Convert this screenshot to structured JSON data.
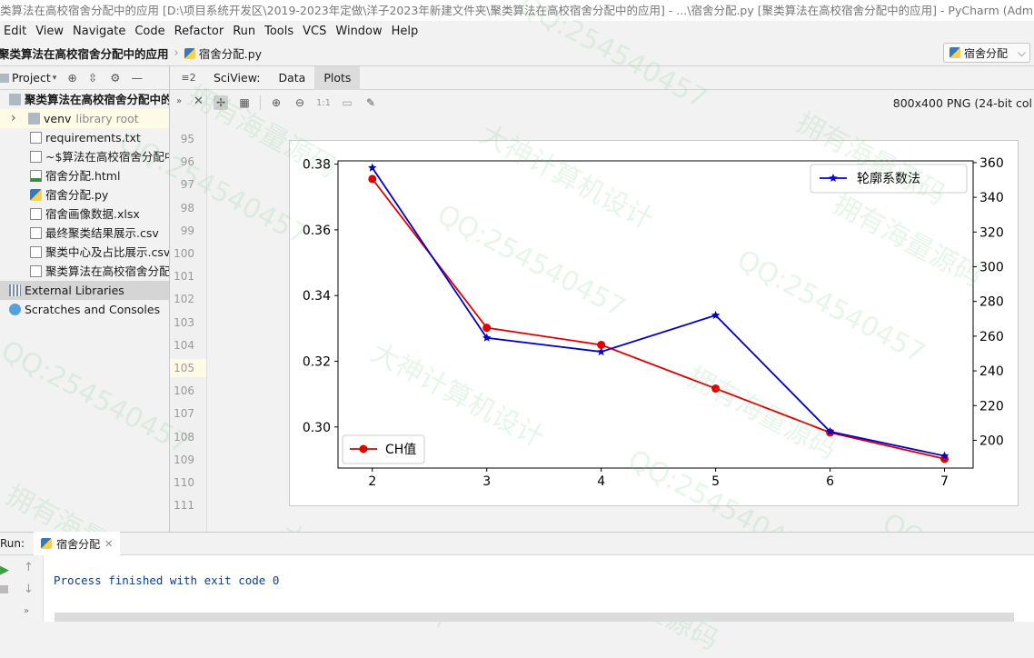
{
  "window": {
    "title": "类算法在高校宿舍分配中的应用 [D:\\项目系统开发区\\2019-2023年定做\\洋子2023年新建文件夹\\聚类算法在高校宿舍分配中的应用] - ...\\宿舍分配.py [聚类算法在高校宿舍分配中的应用] - PyCharm (Administrator)"
  },
  "menu": [
    "Edit",
    "View",
    "Navigate",
    "Code",
    "Refactor",
    "Run",
    "Tools",
    "VCS",
    "Window",
    "Help"
  ],
  "nav": {
    "project": "聚类算法在高校宿舍分配中的应用",
    "file": "宿舍分配.py",
    "run_config": "宿舍分配"
  },
  "project_panel": {
    "header": "Project",
    "tree": [
      {
        "label": "聚类算法在高校宿舍分配中的应用",
        "icon": "folder-icon",
        "indent": 0,
        "bold": true
      },
      {
        "label": "venv",
        "extra": "library root",
        "icon": "folder-icon",
        "indent": 1
      },
      {
        "label": "requirements.txt",
        "icon": "file-icon",
        "indent": 2
      },
      {
        "label": "~$算法在高校宿舍分配中的",
        "icon": "file-icon",
        "indent": 2
      },
      {
        "label": "宿舍分配.html",
        "icon": "html-file-icon",
        "indent": 2
      },
      {
        "label": "宿舍分配.py",
        "icon": "python-file-icon",
        "indent": 2
      },
      {
        "label": "宿舍画像数据.xlsx",
        "icon": "file-icon",
        "indent": 2
      },
      {
        "label": "最终聚类结果展示.csv",
        "icon": "file-icon",
        "indent": 2
      },
      {
        "label": "聚类中心及占比展示.csv",
        "icon": "file-icon",
        "indent": 2
      },
      {
        "label": "聚类算法在高校宿舍分配中的",
        "icon": "file-icon",
        "indent": 2
      },
      {
        "label": "External Libraries",
        "icon": "library-icon",
        "indent": 0
      },
      {
        "label": "Scratches and Consoles",
        "icon": "scratch-icon",
        "indent": 0
      }
    ]
  },
  "gutter": {
    "lines": [
      "95",
      "96",
      "97",
      "98",
      "99",
      "100",
      "101",
      "102",
      "103",
      "104",
      "105",
      "106",
      "107",
      "108",
      "109",
      "110",
      "111"
    ],
    "current": "105"
  },
  "sciview": {
    "label": "SciView:",
    "tabs": [
      "Data",
      "Plots"
    ],
    "active_tab": "Plots",
    "image_info": "800x400 PNG (24-bit col"
  },
  "chart_data": {
    "type": "line",
    "x": [
      2,
      3,
      4,
      5,
      6,
      7
    ],
    "series": [
      {
        "name": "CH值",
        "axis": "left",
        "color": "#e00000",
        "marker": "circle",
        "values": [
          0.3755,
          0.3302,
          0.325,
          0.3117,
          0.2983,
          0.2903
        ]
      },
      {
        "name": "轮廓系数法",
        "axis": "right",
        "color": "#0000cc",
        "marker": "star",
        "values": [
          357,
          259,
          251,
          272,
          205,
          191
        ]
      }
    ],
    "xlim": [
      1.7,
      7.25
    ],
    "ylim_left": [
      0.2875,
      0.381
    ],
    "ylim_right": [
      184,
      361
    ],
    "xticks": [
      "2",
      "3",
      "4",
      "5",
      "6",
      "7"
    ],
    "yticks_left": [
      "0.30",
      "0.32",
      "0.34",
      "0.36",
      "0.38"
    ],
    "yticks_right": [
      "200",
      "220",
      "240",
      "260",
      "280",
      "300",
      "320",
      "340",
      "360"
    ],
    "legend_left": "bottom-left",
    "legend_right": "top-right",
    "grid": false
  },
  "run_panel": {
    "label": "Run:",
    "tab": "宿舍分配",
    "output": "Process finished with exit code 0"
  },
  "watermarks": [
    "QQ:254540457",
    "大神计算机设计",
    "拥有海量源码"
  ]
}
